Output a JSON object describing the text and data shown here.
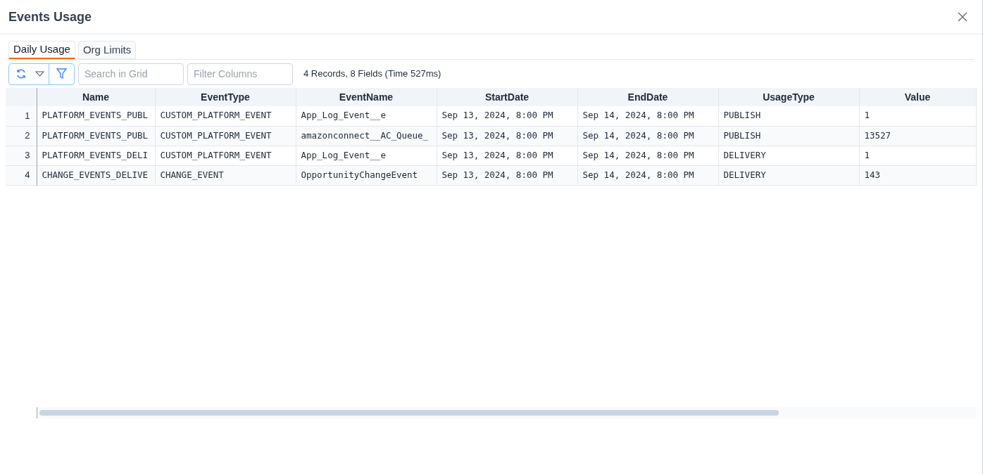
{
  "window": {
    "title": "Events Usage"
  },
  "tabs": [
    {
      "label": "Daily Usage",
      "selected": true
    },
    {
      "label": "Org Limits",
      "selected": false
    }
  ],
  "toolbar": {
    "search": {
      "placeholder": "Search in Grid"
    },
    "filter": {
      "placeholder": "Filter Columns"
    },
    "status": "4 Records, 8 Fields (Time 527ms)"
  },
  "table": {
    "columns": [
      "Name",
      "EventType",
      "EventName",
      "StartDate",
      "EndDate",
      "UsageType",
      "Value"
    ],
    "rows": [
      {
        "number": "1",
        "cells": [
          "PLATFORM_EVENTS_PUBL",
          "CUSTOM_PLATFORM_EVENT",
          "App_Log_Event__e",
          "Sep 13, 2024, 8:00 PM",
          "Sep 14, 2024, 8:00 PM",
          "PUBLISH",
          "1"
        ]
      },
      {
        "number": "2",
        "cells": [
          "PLATFORM_EVENTS_PUBL",
          "CUSTOM_PLATFORM_EVENT",
          "amazonconnect__AC_Queue_",
          "Sep 13, 2024, 8:00 PM",
          "Sep 14, 2024, 8:00 PM",
          "PUBLISH",
          "13527"
        ]
      },
      {
        "number": "3",
        "cells": [
          "PLATFORM_EVENTS_DELI",
          "CUSTOM_PLATFORM_EVENT",
          "App_Log_Event__e",
          "Sep 13, 2024, 8:00 PM",
          "Sep 14, 2024, 8:00 PM",
          "DELIVERY",
          "1"
        ]
      },
      {
        "number": "4",
        "cells": [
          "CHANGE_EVENTS_DELIVE",
          "CHANGE_EVENT",
          "OpportunityChangeEvent",
          "Sep 13, 2024, 8:00 PM",
          "Sep 14, 2024, 8:00 PM",
          "DELIVERY",
          "143"
        ]
      }
    ]
  }
}
